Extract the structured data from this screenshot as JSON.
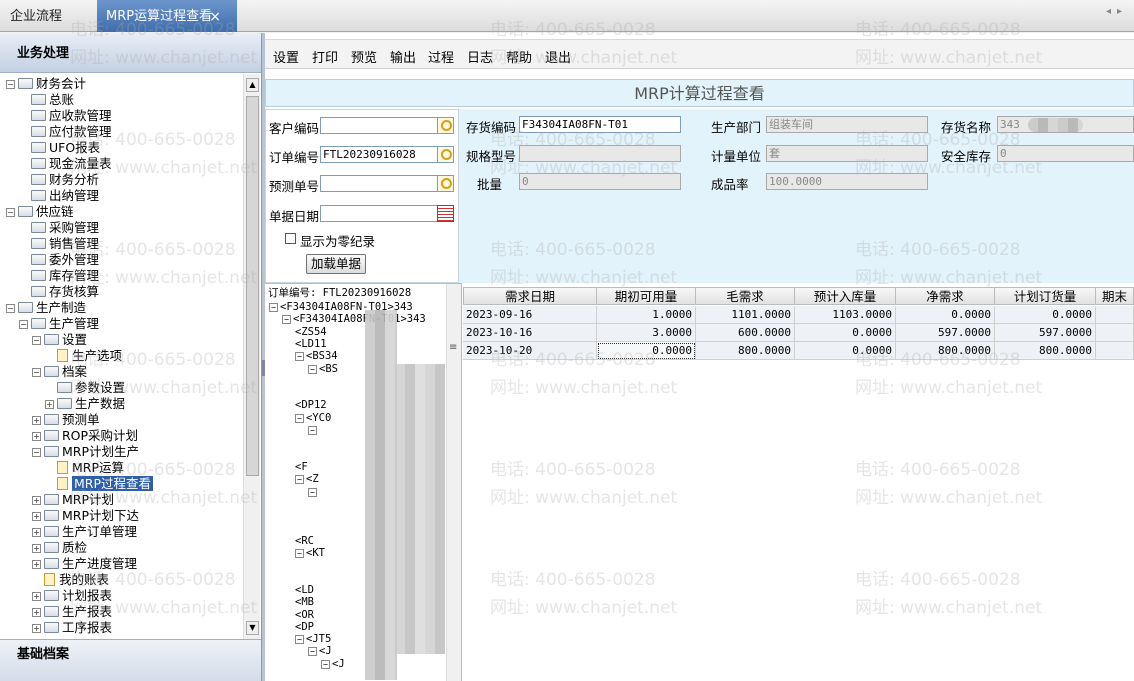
{
  "tabs": {
    "first": "企业流程",
    "active": "MRP运算过程查看",
    "close_glyph": "×"
  },
  "nav": {
    "header": "业务处理",
    "footer": "基础档案",
    "items": [
      {
        "label": "财务会计",
        "level": 0,
        "tw": "−"
      },
      {
        "label": "总账",
        "level": 1
      },
      {
        "label": "应收款管理",
        "level": 1
      },
      {
        "label": "应付款管理",
        "level": 1
      },
      {
        "label": "UFO报表",
        "level": 1
      },
      {
        "label": "现金流量表",
        "level": 1
      },
      {
        "label": "财务分析",
        "level": 1
      },
      {
        "label": "出纳管理",
        "level": 1
      },
      {
        "label": "供应链",
        "level": 0,
        "tw": "−"
      },
      {
        "label": "采购管理",
        "level": 1
      },
      {
        "label": "销售管理",
        "level": 1
      },
      {
        "label": "委外管理",
        "level": 1
      },
      {
        "label": "库存管理",
        "level": 1
      },
      {
        "label": "存货核算",
        "level": 1
      },
      {
        "label": "生产制造",
        "level": 0,
        "tw": "−"
      },
      {
        "label": "生产管理",
        "level": 1,
        "tw": "−"
      },
      {
        "label": "设置",
        "level": 2,
        "tw": "−"
      },
      {
        "label": "生产选项",
        "level": 3,
        "doc": true
      },
      {
        "label": "档案",
        "level": 2,
        "tw": "−"
      },
      {
        "label": "参数设置",
        "level": 3
      },
      {
        "label": "生产数据",
        "level": 3,
        "tw": "+"
      },
      {
        "label": "预测单",
        "level": 2,
        "tw": "+"
      },
      {
        "label": "ROP采购计划",
        "level": 2,
        "tw": "+"
      },
      {
        "label": "MRP计划生产",
        "level": 2,
        "tw": "−"
      },
      {
        "label": "MRP运算",
        "level": 3,
        "doc": true
      },
      {
        "label": "MRP过程查看",
        "level": 3,
        "doc": true,
        "selected": true
      },
      {
        "label": "MRP计划",
        "level": 2,
        "tw": "+"
      },
      {
        "label": "MRP计划下达",
        "level": 2,
        "tw": "+"
      },
      {
        "label": "生产订单管理",
        "level": 2,
        "tw": "+"
      },
      {
        "label": "质检",
        "level": 2,
        "tw": "+"
      },
      {
        "label": "生产进度管理",
        "level": 2,
        "tw": "+"
      },
      {
        "label": "我的账表",
        "level": 2,
        "doc": true
      },
      {
        "label": "计划报表",
        "level": 2,
        "tw": "+"
      },
      {
        "label": "生产报表",
        "level": 2,
        "tw": "+"
      },
      {
        "label": "工序报表",
        "level": 2,
        "tw": "+"
      }
    ]
  },
  "menu": [
    "设置",
    "打印",
    "预览",
    "输出",
    "过程",
    "日志",
    "帮助",
    "退出"
  ],
  "page_title": "MRP计算过程查看",
  "form": {
    "customer_code_label": "客户编码",
    "customer_code": "",
    "order_no_label": "订单编号",
    "order_no": "FTL20230916028",
    "forecast_no_label": "预测单号",
    "forecast_no": "",
    "doc_date_label": "单据日期",
    "doc_date": "",
    "show_zero_label": "显示为零纪录",
    "load_button": "加载单据",
    "inventory_code_label": "存货编码",
    "inventory_code": "F34304IA08FN-T01",
    "spec_label": "规格型号",
    "spec": "",
    "batch_label": "批量",
    "batch": "0",
    "dept_label": "生产部门",
    "dept": "组装车间",
    "unit_label": "计量单位",
    "unit": "套",
    "yield_label": "成品率",
    "yield": "100.0000",
    "name_label": "存货名称",
    "name": "343",
    "safety_label": "安全库存",
    "safety": "0"
  },
  "bom_tree": {
    "root": "订单编号: FTL20230916028",
    "rows": [
      {
        "text": "<F34304IA08FN-T01>343",
        "mk": "−",
        "indent": 0
      },
      {
        "text": "<F34304IA08FN-T01>343",
        "mk": "−",
        "indent": 1
      },
      {
        "text": "<ZS54",
        "mk": "",
        "indent": 2
      },
      {
        "text": "<LD11",
        "mk": "",
        "indent": 2
      },
      {
        "text": "<BS34",
        "mk": "−",
        "indent": 2
      },
      {
        "text": "<BS",
        "mk": "−",
        "indent": 3
      },
      {
        "text": "",
        "mk": "",
        "indent": 3
      },
      {
        "text": "",
        "mk": "",
        "indent": 3
      },
      {
        "text": "<DP12",
        "mk": "",
        "indent": 2
      },
      {
        "text": "<YC0",
        "mk": "−",
        "indent": 2
      },
      {
        "text": "",
        "mk": "−",
        "indent": 3
      },
      {
        "text": "",
        "mk": "",
        "indent": 3
      },
      {
        "text": "",
        "mk": "",
        "indent": 3
      },
      {
        "text": "<F",
        "mk": "",
        "indent": 2
      },
      {
        "text": "<Z",
        "mk": "−",
        "indent": 2
      },
      {
        "text": "",
        "mk": "−",
        "indent": 3
      },
      {
        "text": "",
        "mk": "",
        "indent": 3
      },
      {
        "text": "",
        "mk": "",
        "indent": 3
      },
      {
        "text": "",
        "mk": "",
        "indent": 3
      },
      {
        "text": "<RC",
        "mk": "",
        "indent": 2
      },
      {
        "text": "<KT",
        "mk": "−",
        "indent": 2
      },
      {
        "text": "",
        "mk": "",
        "indent": 3
      },
      {
        "text": "",
        "mk": "",
        "indent": 3
      },
      {
        "text": "<LD",
        "mk": "",
        "indent": 2
      },
      {
        "text": "<MB",
        "mk": "",
        "indent": 2
      },
      {
        "text": "<OR",
        "mk": "",
        "indent": 2
      },
      {
        "text": "<DP",
        "mk": "",
        "indent": 2
      },
      {
        "text": "<JT5",
        "mk": "−",
        "indent": 2
      },
      {
        "text": "<J",
        "mk": "−",
        "indent": 3
      },
      {
        "text": "<J",
        "mk": "−",
        "indent": 4
      }
    ]
  },
  "grid": {
    "columns": [
      "需求日期",
      "期初可用量",
      "毛需求",
      "预计入库量",
      "净需求",
      "计划订货量",
      "期末"
    ],
    "rows": [
      [
        "2023-09-16",
        "1.0000",
        "1101.0000",
        "1103.0000",
        "0.0000",
        "0.0000",
        ""
      ],
      [
        "2023-10-16",
        "3.0000",
        "600.0000",
        "0.0000",
        "597.0000",
        "597.0000",
        ""
      ],
      [
        "2023-10-20",
        "0.0000",
        "800.0000",
        "0.0000",
        "800.0000",
        "800.0000",
        ""
      ]
    ]
  },
  "watermark": {
    "phone": "电话: 400-665-0028",
    "site": "网址: www.chanjet.net"
  }
}
